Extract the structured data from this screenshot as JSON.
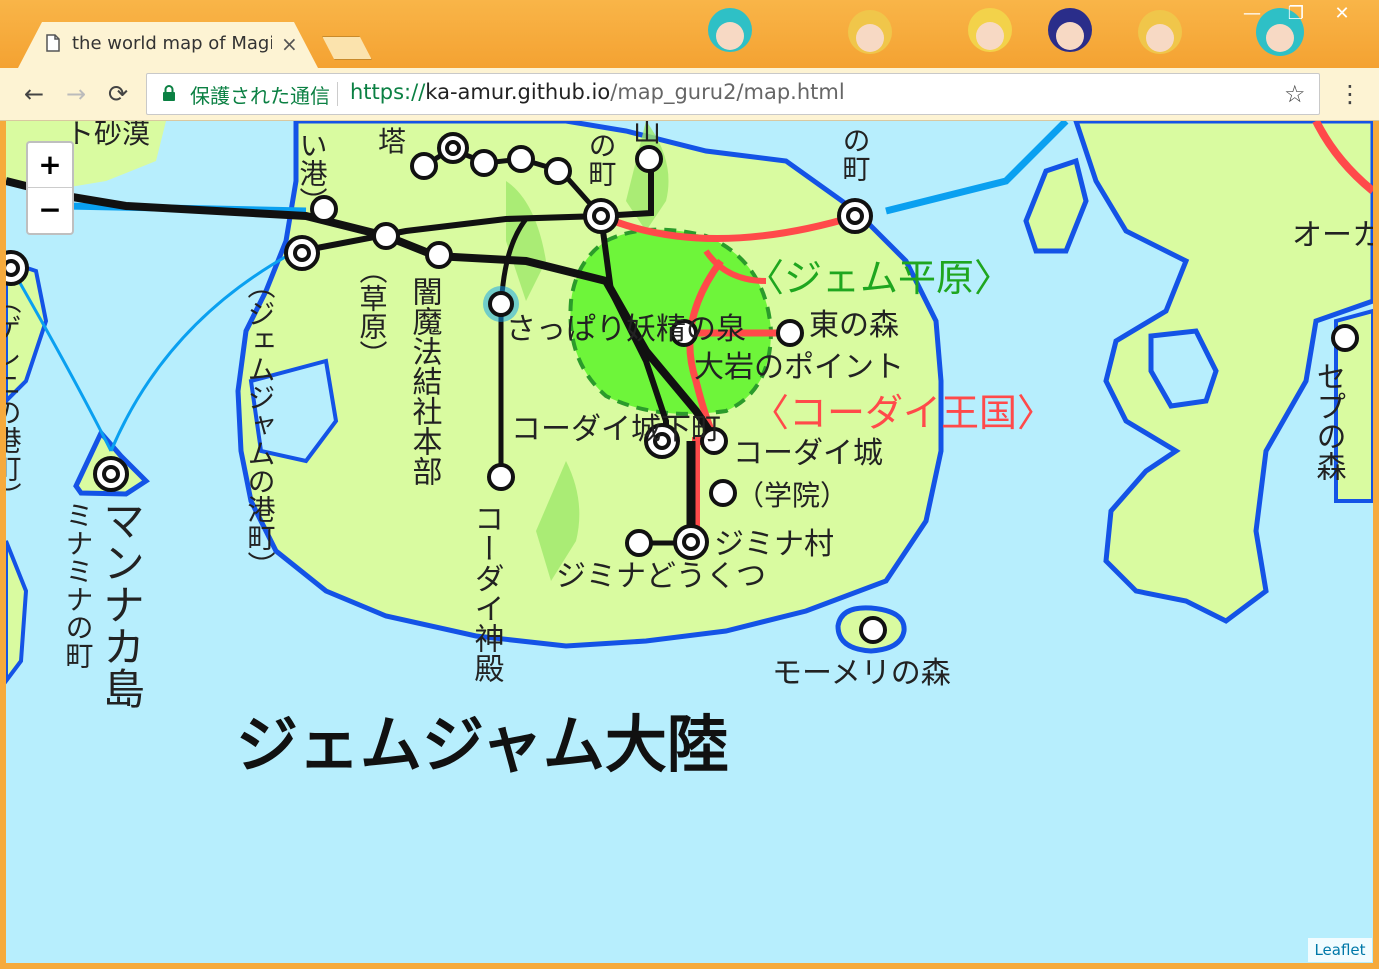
{
  "browser": {
    "tab_title": "the world map of Magi",
    "tab_close": "×",
    "secure_label": "保護された通信",
    "url_scheme": "https://",
    "url_host": "ka-amur.github.io",
    "url_path": "/map_guru2/map.html",
    "back": "←",
    "forward": "→",
    "reload": "⟳",
    "star": "☆",
    "menu": "⋮",
    "minimize": "—",
    "restore": "❐",
    "close": "✕"
  },
  "map": {
    "zoom_in": "+",
    "zoom_out": "−",
    "attribution": "Leaflet",
    "labels": {
      "top_desert": "ト砂漠",
      "tower": "塔",
      "port_top": "い港）",
      "town_top": "の町",
      "mountain": "山",
      "town_top_right": "の町",
      "gem_plain": "〈ジェム平原〉",
      "east_forest": "東の森",
      "big_rock": "大岩のポイント",
      "kodai_kingdom": "〈コーダイ王国〉",
      "kodai_castle": "コーダイ城",
      "academy": "（学院）",
      "jimina_village": "ジミナ村",
      "kodai_castle_town": "コーダイ城下町",
      "jimina_cave": "ジミナどうくつ",
      "kodai_shrine": "コーダイ神殿",
      "fairy_spring": "さっぱり妖精の泉",
      "dark_magic": "闇魔法結社本部",
      "grassland": "（草原）",
      "gemjam_port": "（ジェムジャムの港町）",
      "mannaka_island": "マンナカ島",
      "minamina_town": "ミナミナの町",
      "gereni_town": "（ゲレニの港町）",
      "momeri_forest": "モーメリの森",
      "gemjam_continent": "ジェムジャム大陸",
      "sepu_forest": "セプの森",
      "oka": "オーカ"
    }
  }
}
